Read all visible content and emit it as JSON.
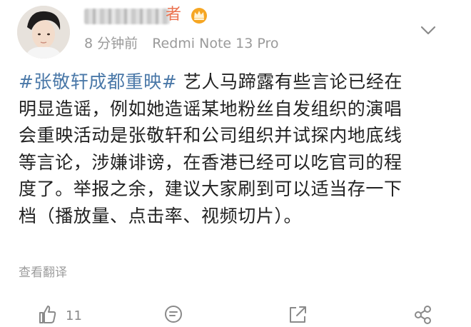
{
  "post": {
    "author_name_suffix": "者",
    "time": "8 分钟前",
    "device": "Redmi Note 13 Pro",
    "hashtag": "#张敬轩成都重映#",
    "lines": [
      " 艺人马蹄露有些言论已经在",
      "明显造谣，例如她造谣某地粉丝自发组织的演唱",
      "会重映活动是张敬轩和公司组织并试探内地底线",
      "等言论，涉嫌诽谤，在香港已经可以吃官司的程",
      "度了。举报之余，建议大家刷到可以适当存一下",
      "档（播放量、点击率、视频切片）。"
    ],
    "translate_label": "查看翻译"
  },
  "actions": {
    "like_count": "11"
  },
  "icons": {
    "vip": "crown-badge-icon",
    "menu": "chevron-down-icon",
    "like": "thumbs-up-icon",
    "comment": "comment-icon",
    "share": "share-icon",
    "more": "more-share-icon"
  },
  "colors": {
    "hashtag": "#4a78a8",
    "name_accent": "#eb7350",
    "meta": "#9a9a9a"
  }
}
